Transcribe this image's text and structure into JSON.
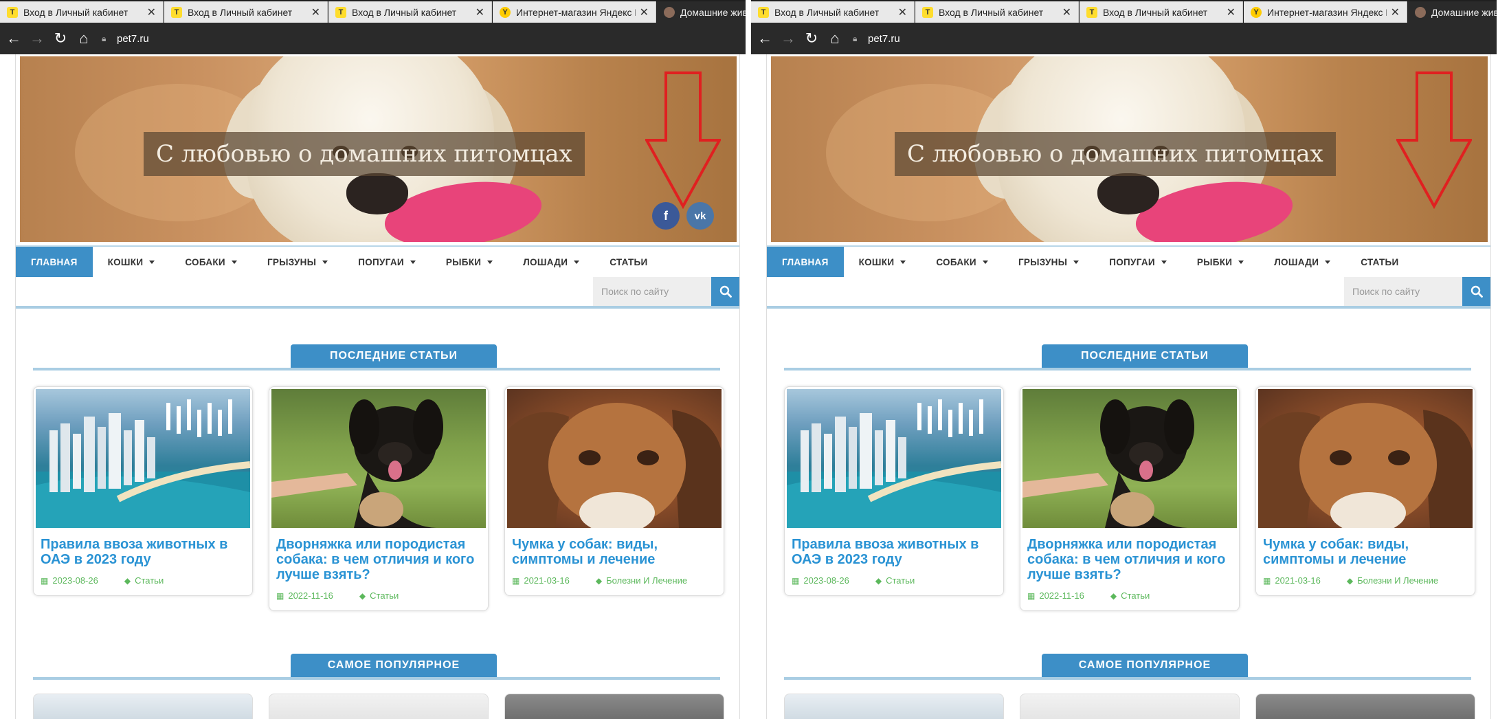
{
  "browser": {
    "tabs": [
      {
        "title": "Вход в Личный кабинет",
        "fav": "T"
      },
      {
        "title": "Вход в Личный кабинет",
        "fav": "T"
      },
      {
        "title": "Вход в Личный кабинет",
        "fav": "T"
      },
      {
        "title": "Интернет-магазин Яндекс Мар",
        "fav": "Y"
      },
      {
        "title": "Домашние жив",
        "fav": ""
      }
    ],
    "url": "pet7.ru"
  },
  "site": {
    "hero_title": "С любовью о домашних питомцах",
    "social": {
      "fb": "f",
      "vk": "vk"
    },
    "menu": [
      {
        "label": "ГЛАВНАЯ",
        "dropdown": false
      },
      {
        "label": "КОШКИ",
        "dropdown": true
      },
      {
        "label": "СОБАКИ",
        "dropdown": true
      },
      {
        "label": "ГРЫЗУНЫ",
        "dropdown": true
      },
      {
        "label": "ПОПУГАИ",
        "dropdown": true
      },
      {
        "label": "РЫБКИ",
        "dropdown": true
      },
      {
        "label": "ЛОШАДИ",
        "dropdown": true
      },
      {
        "label": "СТАТЬИ",
        "dropdown": false
      }
    ],
    "search_placeholder": "Поиск по сайту",
    "latest_label": "ПОСЛЕДНИЕ СТАТЬИ",
    "popular_label": "САМОЕ ПОПУЛЯРНОЕ",
    "articles": [
      {
        "title": "Правила ввоза животных в ОАЭ в 2023 году",
        "date": "2023-08-26",
        "category": "Статьи"
      },
      {
        "title": "Дворняжка или породистая собака: в чем отличия и кого лучше взять?",
        "date": "2022-11-16",
        "category": "Статьи"
      },
      {
        "title": "Чумка у собак: виды, симптомы и лечение",
        "date": "2021-03-16",
        "category": "Болезни И Лечение"
      }
    ]
  },
  "colors": {
    "accent": "#3d8fc7",
    "link": "#2a93d4",
    "meta": "#5cb85c",
    "arrow": "#e02020"
  }
}
